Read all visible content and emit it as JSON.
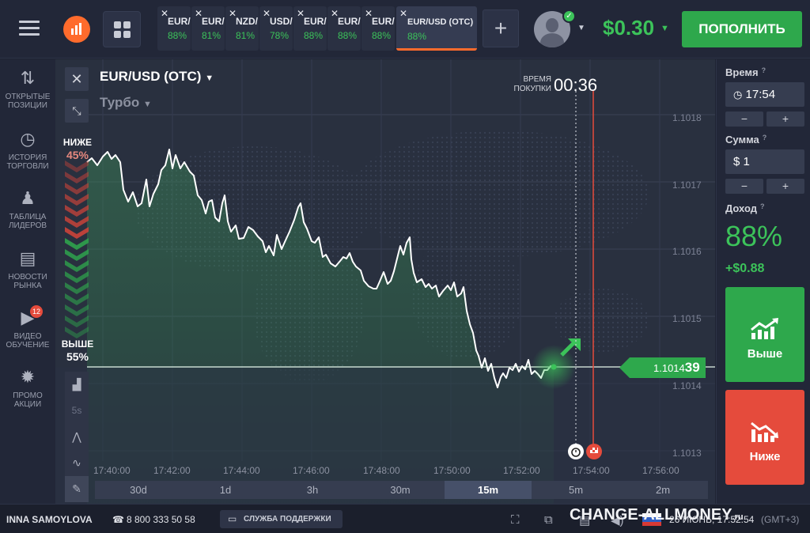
{
  "header": {
    "tabs": [
      {
        "name": "EUR/",
        "payout": "88%"
      },
      {
        "name": "EUR/",
        "payout": "81%"
      },
      {
        "name": "NZD/",
        "payout": "81%"
      },
      {
        "name": "USD/",
        "payout": "78%"
      },
      {
        "name": "EUR/",
        "payout": "88%"
      },
      {
        "name": "EUR/",
        "payout": "88%"
      },
      {
        "name": "EUR/",
        "payout": "88%"
      }
    ],
    "active_tab": {
      "name": "EUR/USD (OTC)",
      "payout": "88%"
    },
    "close_glyph": "✕",
    "add_glyph": "+",
    "balance": "$0.30",
    "deposit_label": "ПОПОЛНИТЬ"
  },
  "sidebar": [
    {
      "label": "ОТКРЫТЫЕ\nПОЗИЦИИ",
      "icon": "arrows-updown-icon"
    },
    {
      "label": "ИСТОРИЯ\nТОРГОВЛИ",
      "icon": "history-icon"
    },
    {
      "label": "ТАБЛИЦА\nЛИДЕРОВ",
      "icon": "leaderboard-icon"
    },
    {
      "label": "НОВОСТИ\nРЫНКА",
      "icon": "news-icon"
    },
    {
      "label": "ВИДЕО\nОБУЧЕНИЕ",
      "icon": "video-icon",
      "badge": "12"
    },
    {
      "label": "ПРОМО\nАКЦИИ",
      "icon": "promo-icon"
    }
  ],
  "chart": {
    "asset": "EUR/USD (OTC)",
    "mode": "Турбо",
    "lower_label": "НИЖЕ",
    "lower_pct": "45%",
    "higher_label": "ВЫШЕ",
    "higher_pct": "55%",
    "purchase_label_1": "ВРЕМЯ",
    "purchase_label_2": "ПОКУПКИ",
    "purchase_timer": "00:36",
    "price_main": "1.1014",
    "price_tail": "39",
    "y_ticks": [
      "1.1018",
      "1.1017",
      "1.1016",
      "1.1015",
      "1.1014",
      "1.1013"
    ],
    "x_ticks": [
      "17:40:00",
      "17:42:00",
      "17:44:00",
      "17:46:00",
      "17:48:00",
      "17:50:00",
      "17:52:00",
      "17:54:00",
      "17:56:00"
    ],
    "tool_timeframe": "5s",
    "periods": [
      "30d",
      "1d",
      "3h",
      "30m",
      "15m",
      "5m",
      "2m"
    ],
    "selected_period": "15m",
    "colors": {
      "up": "#2ea84c",
      "down": "#e54b3c",
      "expiry": "#e54b3c"
    }
  },
  "panel": {
    "time_label": "Время",
    "time_value": "17:54",
    "amount_label": "Сумма",
    "amount_currency": "$",
    "amount_value": "1",
    "minus": "−",
    "plus": "+",
    "income_label": "Доход",
    "income_pct": "88%",
    "income_value": "+$0.88",
    "higher_button": "Выше",
    "lower_button": "Ниже",
    "info_glyph": "?"
  },
  "status": {
    "user": "INNA SAMOYLOVA",
    "phone": "8 800 333 50 58",
    "support": "СЛУЖБА ПОДДЕРЖКИ",
    "watermark_main": "CHANGE-ALLMONEY",
    "watermark_tld": ".ru",
    "datetime": "26 ИЮНЬ, 17:52:54",
    "timezone": "(GMT+3)"
  }
}
